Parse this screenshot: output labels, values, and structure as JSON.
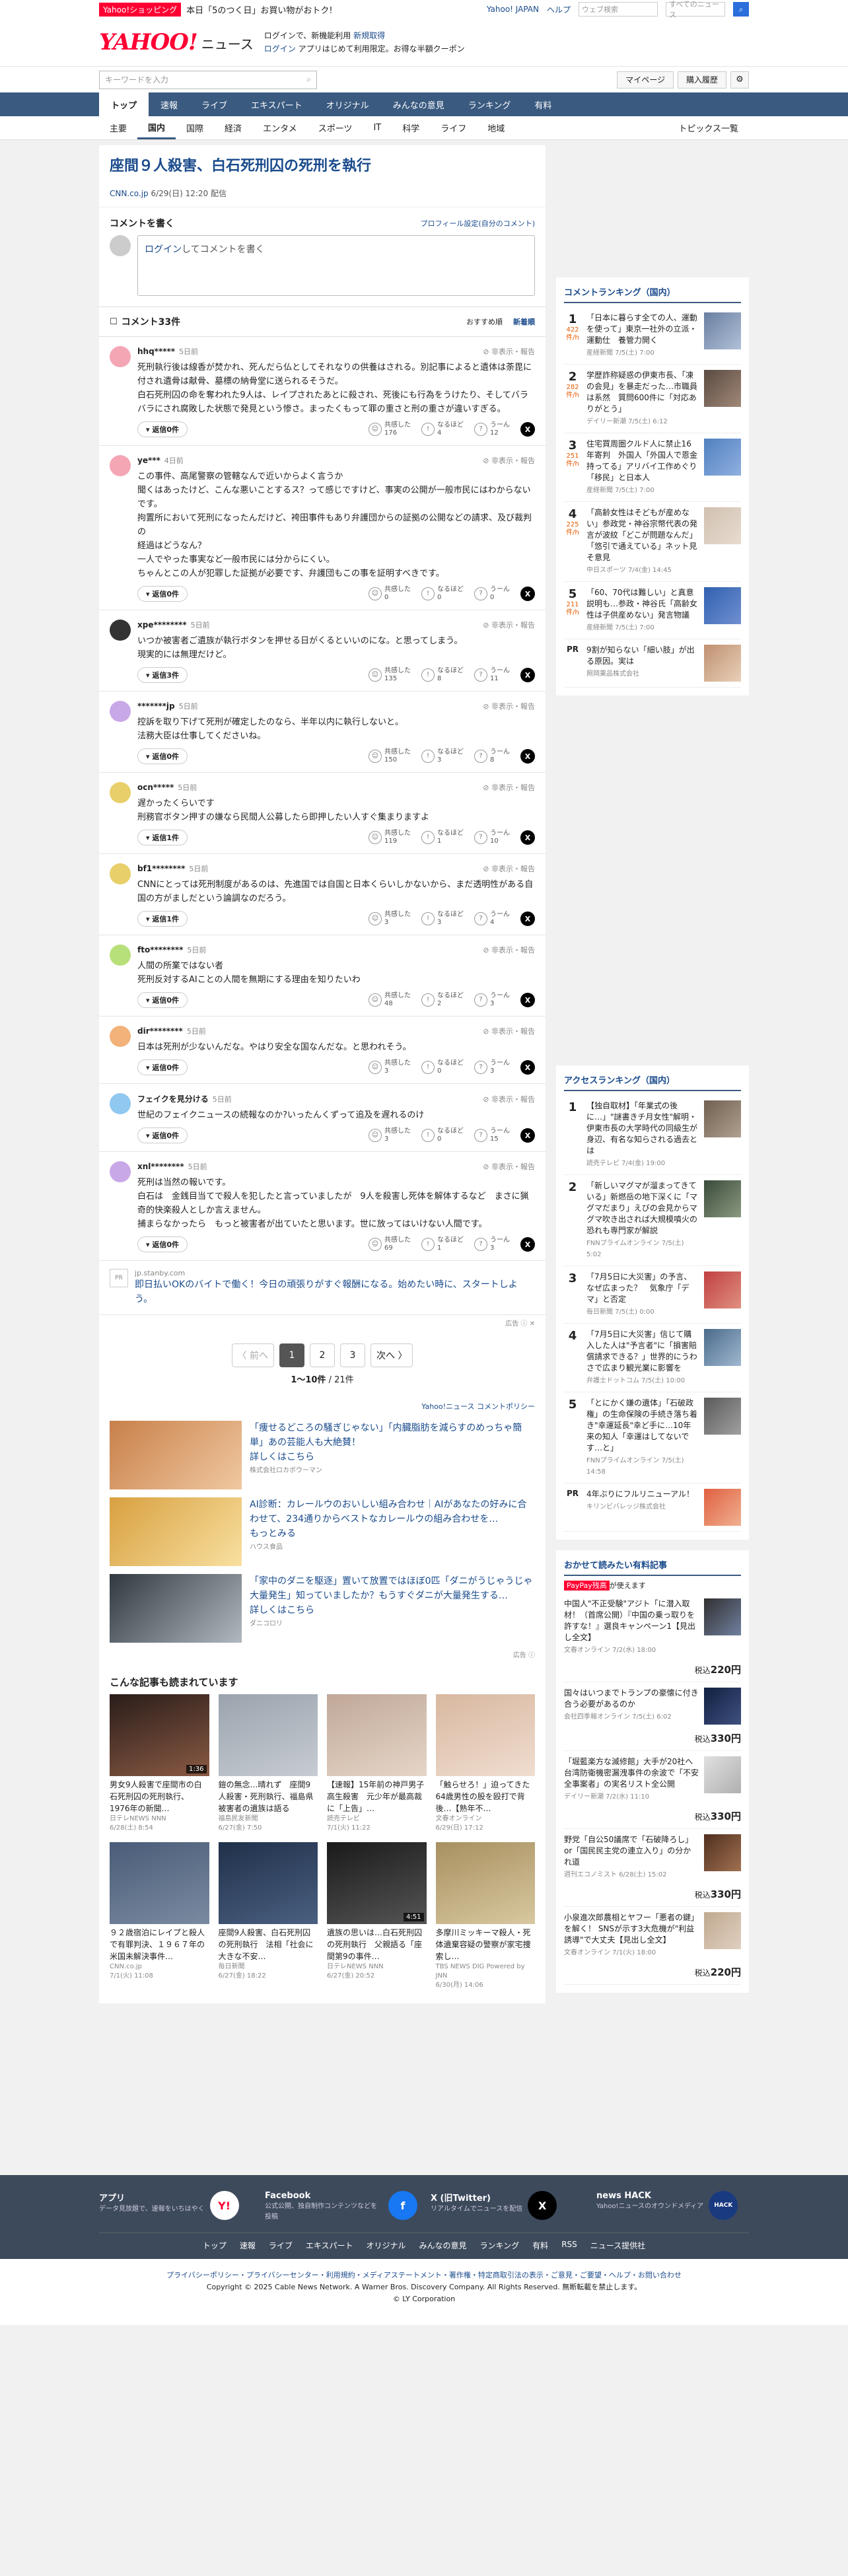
{
  "promo": {
    "tag": "Yahoo!ショッピング",
    "text": "本日「5のつく日」お買い物がおトク!",
    "links": [
      "Yahoo! JAPAN",
      "ヘルプ"
    ],
    "search_placeholder": "ウェブ検索",
    "search_hint": "すべてのニュース"
  },
  "masthead": {
    "logo": "YAHOO!",
    "logo_sub": "JAPAN",
    "service": "ニュース",
    "tagline1": "ログインで、新機能利用 ",
    "tagline_link1": "新規取得",
    "tagline2_link": "ログイン",
    "tagline2": " アプリはじめて利用限定。お得な半額クーポン"
  },
  "searchbar": {
    "placeholder": "キーワードを入力",
    "mypage": "マイページ",
    "history": "購入履歴"
  },
  "mainnav": [
    "トップ",
    "速報",
    "ライブ",
    "エキスパート",
    "オリジナル",
    "みんなの意見",
    "ランキング",
    "有料"
  ],
  "subnav": [
    "主要",
    "国内",
    "国際",
    "経済",
    "エンタメ",
    "スポーツ",
    "IT",
    "科学",
    "ライフ",
    "地域"
  ],
  "subnav_right": "トピックス一覧",
  "article": {
    "title": "座間９人殺害、白石死刑囚の死刑を執行",
    "source": "CNN.co.jp",
    "date": "6/29(日) 12:20 配信"
  },
  "composer": {
    "heading": "コメントを書く",
    "settings": "プロフィール設定(自分のコメント)",
    "login": "ログイン",
    "prompt": "してコメントを書く"
  },
  "comments_head": {
    "title": "コメント33件",
    "sort_recommended": "おすすめ順",
    "sort_new": "新着順"
  },
  "react_labels": {
    "agree": "共感した",
    "think": "なるほど",
    "hmm": "うーん",
    "report": "非表示・報告"
  },
  "comments": [
    {
      "user": "hhq*****",
      "time": "5日前",
      "color": "#f4a6b5",
      "text": "死刑執行後は線香が焚かれ、死んだら仏としてそれなりの供養はされる。別記事によると遺体は荼毘に付され遺骨は献骨、墓標の納骨堂に送られるそうだ。\n白石死刑囚の命を奪われた9人は、レイプされたあとに殺され、死後にも行為をうけたり、そしてバラバラにされ腐敗した状態で発見という惨さ。まったくもって罪の重さと刑の重さが違いすぎる。",
      "replies": "返信0件",
      "agree": "176",
      "think": "4",
      "hmm": "12"
    },
    {
      "user": "ye***",
      "time": "4日前",
      "color": "#f4a6b5",
      "text": "この事件、高尾警察の管轄なんで近いからよく言うか\n聞くはあったけど、こんな悪いことするス？って感じですけど、事実の公開が一般市民にはわからないです。\n拘置所において死刑になったんだけど、袴田事件もあり弁護団からの証拠の公開などの請求、及び裁判の\n経過はどうなん？\n一人でやった事実など一般市民には分からにくい。\nちゃんとこの人が犯罪した証拠が必要です、弁護団もこの事を証明すべきです。",
      "replies": "返信0件",
      "agree": "0",
      "think": "0",
      "hmm": "0"
    },
    {
      "user": "xpe********",
      "time": "5日前",
      "color": "#333",
      "text": "いつか被害者ご遺族が執行ボタンを押せる日がくるといいのにな。と思ってしまう。\n現実的には無理だけど。",
      "replies": "返信3件",
      "agree": "135",
      "think": "8",
      "hmm": "11"
    },
    {
      "user": "*******jp",
      "time": "5日前",
      "color": "#c9a8e8",
      "text": "控訴を取り下げて死刑が確定したのなら、半年以内に執行しないと。\n法務大臣は仕事してくださいね。",
      "replies": "返信0件",
      "agree": "150",
      "think": "3",
      "hmm": "8"
    },
    {
      "user": "ocn*****",
      "time": "5日前",
      "color": "#e8cf6a",
      "text": "遅かったくらいです\n刑務官ボタン押すの嫌なら民間人公募したら即押したい人すぐ集まりますよ",
      "replies": "返信1件",
      "agree": "119",
      "think": "1",
      "hmm": "10"
    },
    {
      "user": "bf1********",
      "time": "5日前",
      "color": "#e8cf6a",
      "text": "CNNにとっては死刑制度があるのは、先進国では自国と日本くらいしかないから、まだ透明性がある自国の方がましだという論調なのだろう。",
      "replies": "返信1件",
      "agree": "3",
      "think": "3",
      "hmm": "4"
    },
    {
      "user": "fto********",
      "time": "5日前",
      "color": "#b8e07a",
      "text": "人間の所業ではない者\n死刑反対するAIことの人間を無期にする理由を知りたいわ",
      "replies": "返信0件",
      "agree": "48",
      "think": "2",
      "hmm": "3"
    },
    {
      "user": "dir********",
      "time": "5日前",
      "color": "#f2b27a",
      "text": "日本は死刑が少ないんだな。やはり安全な国なんだな。と思われそう。",
      "replies": "返信0件",
      "agree": "3",
      "think": "0",
      "hmm": "3"
    },
    {
      "user": "フェイクを見分ける",
      "time": "5日前",
      "color": "#8fc8f0",
      "text": "世紀のフェイクニュースの続報なのか?いったんくずって追及を遅れるのけ",
      "replies": "返信0件",
      "agree": "3",
      "think": "0",
      "hmm": "15"
    },
    {
      "user": "xnl********",
      "time": "5日前",
      "color": "#c9a8e8",
      "text": "死刑は当然の報いです。\n白石は　金銭目当てで殺人を犯したと言っていましたが　9人を殺害し死体を解体するなど　まさに猟奇的快楽殺人としか言えません。\n捕まらなかったら　もっと被害者が出ていたと思います。世に放ってはいけない人間です。",
      "replies": "返信0件",
      "agree": "69",
      "think": "1",
      "hmm": "3"
    }
  ],
  "inline_ad": {
    "pr": "PR",
    "domain": "jp.stanby.com",
    "title": "即日払いOKのバイトで働く！今日の頑張りがすぐ報酬になる。始めたい時に、スタートしよう。",
    "mark": "広告"
  },
  "pager": {
    "prev": "〈 前へ",
    "pages": [
      "1",
      "2",
      "3"
    ],
    "next": "次へ 〉",
    "count_current": "1〜10件",
    "count_total": "/ 21件"
  },
  "policy": "Yahoo!ニュース コメントポリシー",
  "ads": [
    {
      "title": "「痩せるどころの騒ぎじゃない」「内臓脂肪を減らすのめっちゃ簡単」あの芸能人も大絶賛！",
      "more": "詳しくはこちら",
      "sponsor": "株式会社ロカボウーマン"
    },
    {
      "title": "AI診断：カレールウのおいしい組み合わせ｜AIがあなたの好みに合わせて、234通りからベストなカレールウの組み合わせを…",
      "more": "もっとみる",
      "sponsor": "ハウス食品"
    },
    {
      "title": "「家中のダニを駆逐」置いて放置ではほぼ0匹「ダニがうじゃうじゃ大量発生」知っていましたか？もうすぐダニが大量発生する…",
      "more": "詳しくはこちら",
      "sponsor": "ダニコロリ"
    }
  ],
  "ad_mark": "広告",
  "read_head": "こんな記事も読まれています",
  "read_cards": [
    {
      "title": "男女9人殺害で座間市の白石死刑囚の死刑執行、1976年の新聞…",
      "src": "日テレNEWS NNN",
      "date": "6/28(土) 8:54",
      "dur": "1:36",
      "c1": "#2a1d1a",
      "c2": "#8a5a44"
    },
    {
      "title": "鎧の無念…晴れず　座間9人殺害・死刑執行、福島県被害者の遺族は語る",
      "src": "福島民友新聞",
      "date": "6/27(金) 7:50",
      "dur": "",
      "c1": "#9aa3ad",
      "c2": "#c7ccd2"
    },
    {
      "title": "【速報】15年前の神戸男子高生殺害　元少年が最高裁に「上告」…",
      "src": "読売テレビ",
      "date": "7/1(火) 11:22",
      "dur": "",
      "c1": "#c0a898",
      "c2": "#e6d6c8"
    },
    {
      "title": "「触らせろ！」迫ってきた64歳男性の股を殴打で背後…【熟年不…",
      "src": "文春オンライン",
      "date": "6/29(日) 17:12",
      "dur": "",
      "c1": "#d8b8a0",
      "c2": "#f0ddd0"
    },
    {
      "title": "９２歳宿泊にレイプと殺人で有罪判決、１９６７年の米国未解決事件…",
      "src": "CNN.co.jp",
      "date": "7/1(火) 11:08",
      "dur": "",
      "c1": "#4a5c78",
      "c2": "#7a8aa0"
    },
    {
      "title": "座間9人殺害、白石死刑囚の死刑執行　法相「社会に大きな不安…",
      "src": "毎日新聞",
      "date": "6/27(金) 18:22",
      "dur": "",
      "c1": "#20304a",
      "c2": "#4a6080"
    },
    {
      "title": "遺族の思いは…白石死刑囚の死刑執行　父親語る「座間第9の事件…",
      "src": "日テレNEWS NNN",
      "date": "6/27(金) 20:52",
      "dur": "4:51",
      "c1": "#1a1a1a",
      "c2": "#555"
    },
    {
      "title": "多摩川ミッキーマ殺人・死体遺棄容疑の警察が家宅捜索し…",
      "src": "TBS NEWS DIG Powered by JNN",
      "date": "6/30(月) 14:06",
      "dur": "",
      "c1": "#a89060",
      "c2": "#d8c8a0"
    }
  ],
  "comment_ranking": {
    "title": "コメントランキング（国内）",
    "unit": "件/h",
    "items": [
      {
        "num": "1",
        "count": "422",
        "title": "「日本に暮らす全ての人、運動を使って」東京一社外の立派・運動仕　養管力開く",
        "src": "産経新聞 7/5(土) 7:00",
        "c1": "#6a7fa0",
        "c2": "#b0c0d8"
      },
      {
        "num": "2",
        "count": "282",
        "title": "学歴詐称疑惑の伊東市長、「凍の会見」を暴走だった…市職員は系然　質問600件に「対応ありがとう」",
        "src": "デイリー新潮 7/5(土) 6:12",
        "c1": "#5a4a40",
        "c2": "#a08878"
      },
      {
        "num": "3",
        "count": "251",
        "title": "住宅買周圏クルド人に禁止16年寄判　外国人「外国人で恩金持ってる」アリバイ工作めぐり「移民」と日本人",
        "src": "産経新聞 7/5(土) 7:00",
        "c1": "#5080c0",
        "c2": "#90b0e0"
      },
      {
        "num": "4",
        "count": "225",
        "title": "「高齢女性はそどもが産めない」参政党・神谷宗幣代表の発言が波紋「どこが問題なんだ」「悠引で通えている」ネット見そ意見",
        "src": "中日スポーツ 7/4(金) 14:45",
        "c1": "#d0c0b0",
        "c2": "#e8dcd0"
      },
      {
        "num": "5",
        "count": "211",
        "title": "「60、70代は難しい」と真意説明も…参政・神谷氏「高齢女性は子供産めない」発言物議",
        "src": "産経新聞 7/5(土) 7:00",
        "c1": "#3060b0",
        "c2": "#7090d0"
      }
    ],
    "pr_title": "9割が知らない「細い肢」が出る原因。実は",
    "pr_src": "照岡薬品株式会社"
  },
  "access_ranking": {
    "title": "アクセスランキング（国内）",
    "items": [
      {
        "num": "1",
        "title": "【独自取材】「年業式の後に…」\"謎書きチ月女性\"解明・伊東市長の大学時代の同級生が身辺、有名な知らされる過去とは",
        "src": "読売テレビ 7/4(金) 19:00",
        "c1": "#706050",
        "c2": "#b0a090"
      },
      {
        "num": "2",
        "title": "「新しいマグマが溜まってきている」新燃岳の地下深くに「マグマだまり」えびの会見からマグマ吹き出されば大規模噴火の恐れも専門家が解説",
        "src": "FNNプライムオンライン 7/5(土) 5:02",
        "c1": "#3a4a3a",
        "c2": "#8a9a80"
      },
      {
        "num": "3",
        "title": "「7月5日に大災害」の予言、なぜ広まった？　気象庁「デマ」と否定",
        "src": "毎日新聞 7/5(土) 0:00",
        "c1": "#c04040",
        "c2": "#e09080"
      },
      {
        "num": "4",
        "title": "「7月5日に大災害」信じて購入した人は\"予言者\"に「損害賠償請求できる？」世界的にうわさで広まり観光業に影響を",
        "src": "弁護士ドットコム 7/5(土) 10:00",
        "c1": "#4a6a8a",
        "c2": "#a0b8d0"
      },
      {
        "num": "5",
        "title": "「とにかく嫌の遺体」「石破政権」の生命保険の手続き落ち着き\"幸運延長\"幸ど手に…10年来の知人「幸運はしてないです…と」",
        "src": "FNNプライムオンライン 7/5(土) 14:58",
        "c1": "#5a5a5a",
        "c2": "#a0a0a0"
      }
    ],
    "pr_title": "4年ぶりにフルリニューアル！",
    "pr_src": "キリンビバレッジ株式会社"
  },
  "paid": {
    "title": "おかせて読みたい有料記事",
    "badge": "PayPay残高",
    "badge_text": "が使えます",
    "yen": "税込",
    "items": [
      {
        "title": "中国人\"不正受験\"アジト「に潜入取材！（首席公開）『中国の乗っ取りを許すな！』選良キャンペーン1【見出し全文】",
        "src": "文春オンライン 7/2(水) 18:00",
        "price": "220円",
        "c1": "#303030",
        "c2": "#7080a0"
      },
      {
        "title": "国々はいつまでトランプの豪懐に付き合う必要があるのか",
        "src": "会社四季報オンライン 7/5(土) 6:02",
        "price": "330円",
        "c1": "#102040",
        "c2": "#405080"
      },
      {
        "title": "「堀藍楽方な滅修館」大手が20社へ　台湾防衛機密漏洩事件の余波で「不安全事案者」の実名リスト全公開",
        "src": "デイリー新潮 7/2(水) 11:10",
        "price": "330円",
        "c1": "#e0e0e0",
        "c2": "#b0b0b0"
      },
      {
        "title": "野党「自公50議席で「石破降ろし」or「国民民主党の連立入り」の分かれ道",
        "src": "週刊エコノミスト 6/28(土) 15:02",
        "price": "330円",
        "c1": "#503020",
        "c2": "#a07050"
      },
      {
        "title": "小泉進次郎農相とヤフー「悪者の鍵」を解く！ SNSが示す3大危機が\"利益誘導\"で大丈夫【見出し全文】",
        "src": "文春オンライン 7/1(火) 18:00",
        "price": "220円",
        "c1": "#c0a890",
        "c2": "#e0d0c0"
      }
    ]
  },
  "footer": {
    "apps": [
      {
        "name": "アプリ",
        "desc": "データ見放題で、速報をいちはやく",
        "icon": "Y!"
      },
      {
        "name": "Facebook",
        "desc": "公式公開、独自制作コンテンツなどを投稿",
        "icon": "f"
      },
      {
        "name": "X (旧Twitter)",
        "desc": "リアルタイムでニュースを配信",
        "icon": "X"
      },
      {
        "name": "news HACK",
        "desc": "Yahoo!ニュースのオウンドメディア",
        "icon": "HACK"
      }
    ],
    "nav": [
      "トップ",
      "速報",
      "ライブ",
      "エキスパート",
      "オリジナル",
      "みんなの意見",
      "ランキング",
      "有料",
      "RSS",
      "ニュース提供社"
    ],
    "links": "プライバシーポリシー・プライバシーセンター・利用規約・メディアステートメント・著作権・特定商取引法の表示・ご意見・ご要望・ヘルプ・お問い合わせ",
    "copyright1": "Copyright © 2025 Cable News Network. A Warner Bros. Discovery Company. All Rights Reserved. 無断転載を禁止します。",
    "copyright2": "© LY Corporation"
  }
}
